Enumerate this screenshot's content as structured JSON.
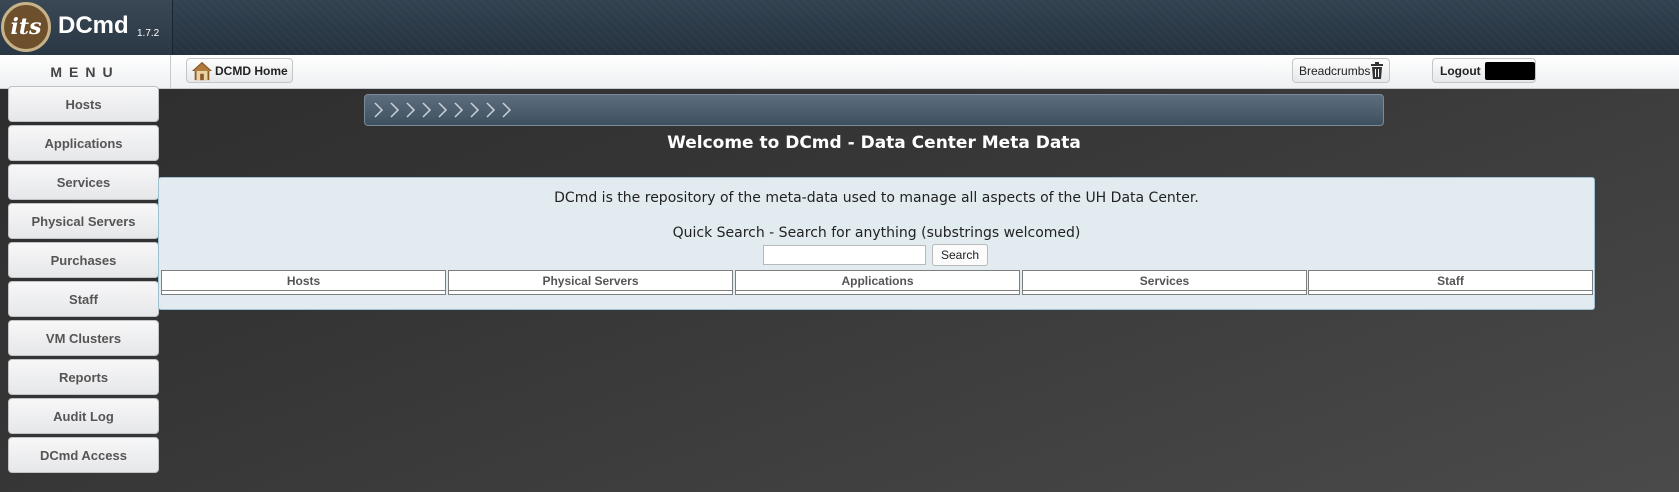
{
  "app": {
    "logo_text": "its",
    "title": "DCmd",
    "version": "1.7.2"
  },
  "nav": {
    "menu_label": "MENU",
    "home_label": "DCMD Home",
    "breadcrumbs_label": "Breadcrumbs",
    "logout_label": "Logout"
  },
  "sidebar": {
    "items": [
      {
        "label": "Hosts"
      },
      {
        "label": "Applications"
      },
      {
        "label": "Services"
      },
      {
        "label": "Physical Servers"
      },
      {
        "label": "Purchases"
      },
      {
        "label": "Staff"
      },
      {
        "label": "VM Clusters"
      },
      {
        "label": "Reports"
      },
      {
        "label": "Audit Log"
      },
      {
        "label": "DCmd Access"
      }
    ]
  },
  "main": {
    "welcome": "Welcome to DCmd - Data Center Meta Data",
    "description": "DCmd is the repository of the meta-data used to manage all aspects of the UH Data Center.",
    "quick_search_label": "Quick Search - Search for anything (substrings welcomed)",
    "search_value": "",
    "search_button": "Search",
    "result_columns": [
      "Hosts",
      "Physical Servers",
      "Applications",
      "Services",
      "Staff"
    ]
  },
  "icons": {
    "home": "home-icon",
    "trash": "trash-icon",
    "breadcrumb_arrows": "chevron-right-icon"
  },
  "colors": {
    "banner": "#2a3744",
    "panel_bg": "#e1ebf0",
    "logo_brown": "#6d4f2c"
  }
}
